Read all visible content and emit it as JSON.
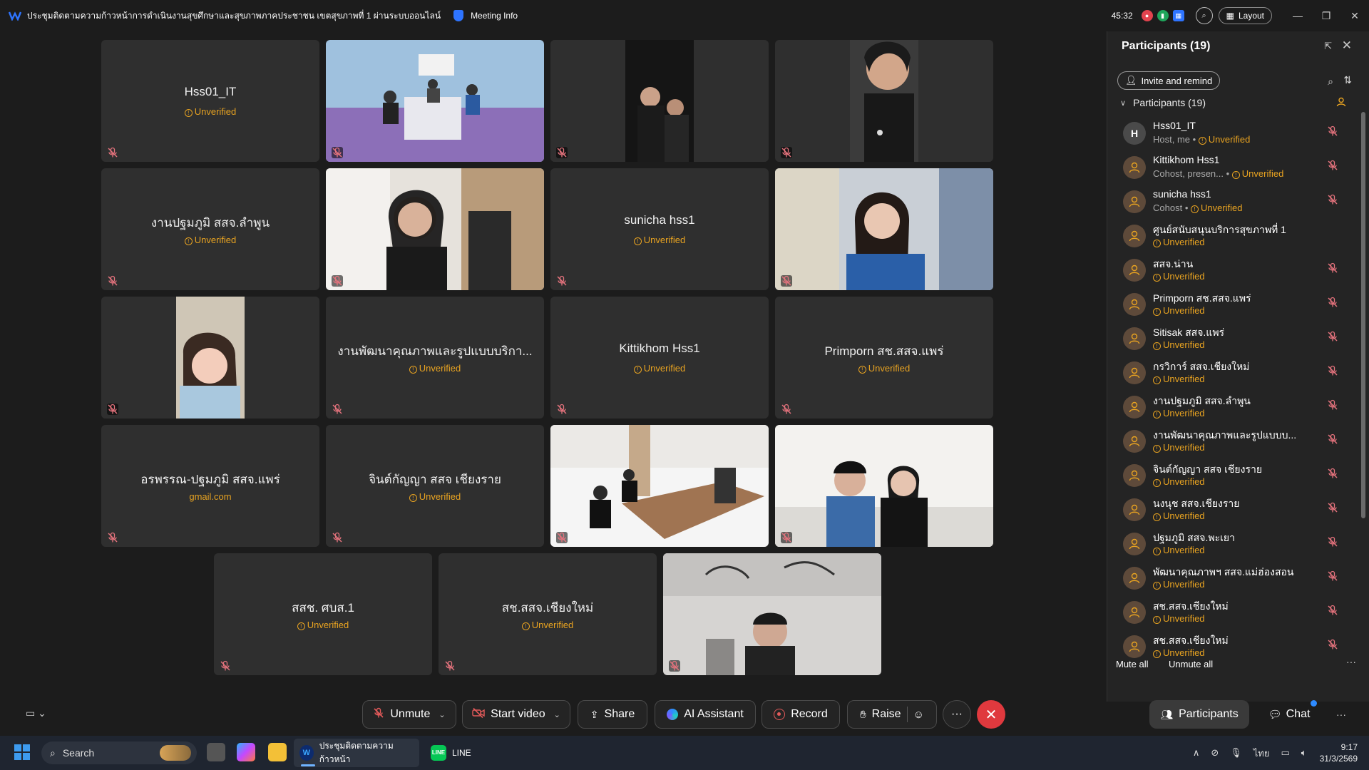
{
  "titlebar": {
    "meeting_title": "ประชุมติดตามความก้าวหน้าการดำเนินงานสุขศึกษาและสุขภาพภาคประชาชน เขตสุขภาพที่ 1 ผ่านระบบออนไลน์",
    "meeting_info": "Meeting Info",
    "timer": "45:32",
    "layout_label": "Layout"
  },
  "tiles": [
    {
      "name": "Hss01_IT",
      "sub": "Unverified",
      "video": false
    },
    {
      "name": "",
      "sub": "",
      "video": true,
      "scene": "meeting-room"
    },
    {
      "name": "",
      "sub": "",
      "video": true,
      "scene": "night-portrait"
    },
    {
      "name": "",
      "sub": "",
      "video": true,
      "scene": "portrait"
    },
    {
      "name": "งานปฐมภูมิ สสจ.ลำพูน",
      "sub": "Unverified",
      "video": false
    },
    {
      "name": "",
      "sub": "",
      "video": true,
      "scene": "office-woman"
    },
    {
      "name": "sunicha hss1",
      "sub": "Unverified",
      "video": false
    },
    {
      "name": "",
      "sub": "",
      "video": true,
      "scene": "woman-smiling"
    },
    {
      "name": "",
      "sub": "",
      "video": true,
      "scene": "car-selfie"
    },
    {
      "name": "งานพัฒนาคุณภาพและรูปแบบบริกา...",
      "sub": "Unverified",
      "video": false
    },
    {
      "name": "Kittikhom Hss1",
      "sub": "Unverified",
      "video": false
    },
    {
      "name": "Primporn สช.สสจ.แพร่",
      "sub": "Unverified",
      "video": false
    },
    {
      "name": "อรพรรณ-ปฐมภูมิ สสจ.แพร่",
      "sub": "gmail.com",
      "video": false,
      "sub_plain": true
    },
    {
      "name": "จินต์กัญญา สสจ เชียงราย",
      "sub": "Unverified",
      "video": false
    },
    {
      "name": "",
      "sub": "",
      "video": true,
      "scene": "conference-table"
    },
    {
      "name": "",
      "sub": "",
      "video": true,
      "scene": "two-people"
    },
    {
      "name": "สสช. ศบส.1",
      "sub": "Unverified",
      "video": false
    },
    {
      "name": "สช.สสจ.เชียงใหม่",
      "sub": "Unverified",
      "video": false
    },
    {
      "name": "",
      "sub": "",
      "video": true,
      "scene": "man-room"
    }
  ],
  "panel": {
    "title": "Participants (19)",
    "invite_label": "Invite and remind",
    "group_label": "Participants (19)",
    "mute_all": "Mute all",
    "unmute_all": "Unmute all",
    "participants": [
      {
        "name": "Hss01_IT",
        "meta": "Host, me",
        "initial": "H",
        "me": true
      },
      {
        "name": "Kittikhom Hss1",
        "meta": "Cohost, presen..."
      },
      {
        "name": "sunicha hss1",
        "meta": "Cohost"
      },
      {
        "name": "ศูนย์สนับสนุนบริการสุขภาพที่ 1",
        "meta": "",
        "no_mic": true
      },
      {
        "name": "สสจ.น่าน",
        "meta": ""
      },
      {
        "name": "Primporn สช.สสจ.แพร่",
        "meta": ""
      },
      {
        "name": "Sitisak สสจ.แพร่",
        "meta": ""
      },
      {
        "name": "กรวิการ์ สสจ.เชียงใหม่",
        "meta": ""
      },
      {
        "name": "งานปฐมภูมิ สสจ.ลำพูน",
        "meta": ""
      },
      {
        "name": "งานพัฒนาคุณภาพและรูปแบบบ...",
        "meta": ""
      },
      {
        "name": "จินต์กัญญา สสจ เชียงราย",
        "meta": ""
      },
      {
        "name": "นงนุช สสจ.เชียงราย",
        "meta": ""
      },
      {
        "name": "ปฐมภูมิ สสจ.พะเยา",
        "meta": ""
      },
      {
        "name": "พัฒนาคุณภาพฯ สสจ.แม่ฮ่องสอน",
        "meta": ""
      },
      {
        "name": "สช.สสจ.เชียงใหม่",
        "meta": ""
      },
      {
        "name": "สช.สสจ.เชียงใหม่",
        "meta": ""
      }
    ],
    "unverified_label": "Unverified"
  },
  "toolbar": {
    "unmute": "Unmute",
    "start_video": "Start video",
    "share": "Share",
    "ai_assistant": "AI Assistant",
    "record": "Record",
    "raise": "Raise",
    "more": "···",
    "participants": "Participants",
    "chat": "Chat"
  },
  "taskbar": {
    "search_label": "Search",
    "app_label": "ประชุมติดตามความก้าวหน้า",
    "line_label": "LINE",
    "lang": "ไทย",
    "time": "9:17",
    "date": "31/3/2569"
  },
  "colors": {
    "unverified": "#e8a321",
    "leave": "#e0393e",
    "accent": "#2e74ff"
  }
}
